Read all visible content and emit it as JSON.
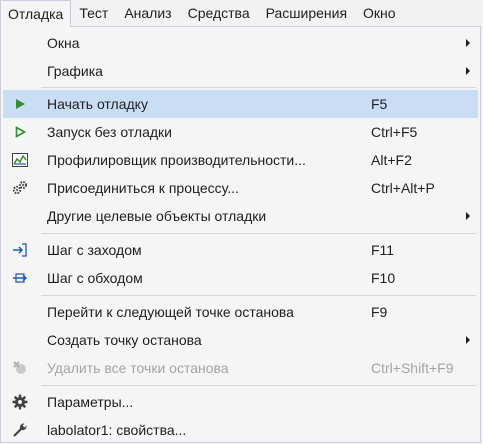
{
  "menubar": {
    "items": [
      {
        "label": "Отладка"
      },
      {
        "label": "Тест"
      },
      {
        "label": "Анализ"
      },
      {
        "label": "Средства"
      },
      {
        "label": "Расширения"
      },
      {
        "label": "Окно"
      }
    ]
  },
  "menu": {
    "windows": {
      "label": "Окна"
    },
    "graphics": {
      "label": "Графика"
    },
    "start_debugging": {
      "label": "Начать отладку",
      "shortcut": "F5",
      "icon": "play-filled-icon"
    },
    "start_without_debugging": {
      "label": "Запуск без отладки",
      "shortcut": "Ctrl+F5",
      "icon": "play-outline-icon"
    },
    "profiler": {
      "label": "Профилировщик производительности...",
      "shortcut": "Alt+F2",
      "icon": "performance-profiler-icon"
    },
    "attach": {
      "label": "Присоединиться к процессу...",
      "shortcut": "Ctrl+Alt+P",
      "icon": "attach-process-icon"
    },
    "other_targets": {
      "label": "Другие целевые объекты отладки"
    },
    "step_into": {
      "label": "Шаг с заходом",
      "shortcut": "F11",
      "icon": "step-into-icon"
    },
    "step_over": {
      "label": "Шаг с обходом",
      "shortcut": "F10",
      "icon": "step-over-icon"
    },
    "next_breakpoint": {
      "label": "Перейти к следующей точке останова",
      "shortcut": "F9"
    },
    "new_breakpoint": {
      "label": "Создать точку останова"
    },
    "delete_breakpoints": {
      "label": "Удалить все точки останова",
      "shortcut": "Ctrl+Shift+F9",
      "icon": "delete-breakpoints-icon"
    },
    "options": {
      "label": "Параметры...",
      "icon": "gear-icon"
    },
    "properties": {
      "label": "labolator1: свойства...",
      "icon": "wrench-icon"
    }
  },
  "colors": {
    "hover": "#c9def5",
    "play_green": "#388a34",
    "disabled_text": "#a2a4a5"
  }
}
